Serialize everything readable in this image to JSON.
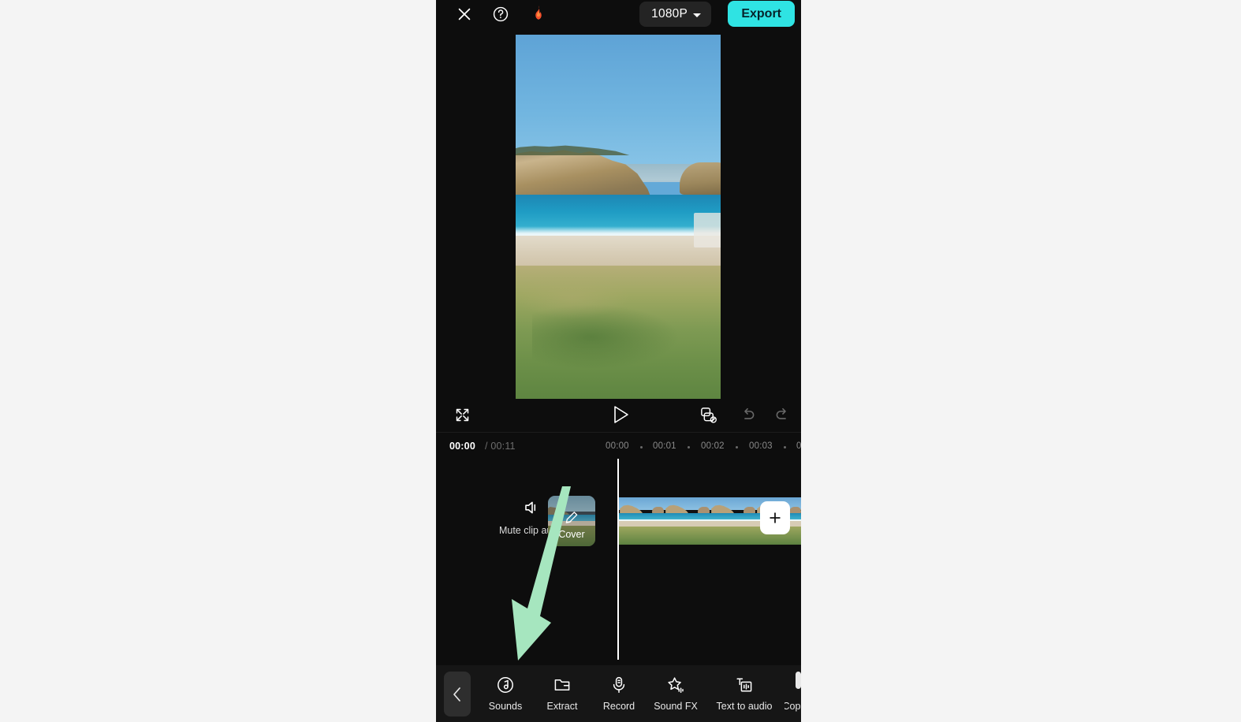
{
  "app": {
    "name": "video-editor"
  },
  "topbar": {
    "close_icon": "close-icon",
    "help_icon": "help-circle-icon",
    "flame_icon": "flame-icon",
    "flame_glyph": "🔥",
    "resolution_label": "1080P",
    "export_label": "Export",
    "export_color": "#2fe3e3"
  },
  "player": {
    "expand_icon": "fullscreen-icon",
    "play_icon": "play-icon",
    "no_duplicate_icon": "no-duplicate-icon",
    "undo_icon": "undo-icon",
    "redo_icon": "redo-icon"
  },
  "timeline": {
    "current_time": "00:00",
    "separator": "/",
    "total_time": "00:11",
    "ruler_labels": [
      "00:00",
      "00:01",
      "00:02",
      "00:03"
    ],
    "mute_label": "Mute clip audio",
    "mute_icon": "speaker-icon",
    "cover_label": "Cover",
    "cover_edit_icon": "pencil-icon",
    "add_label": "+",
    "playhead_position": "00:00"
  },
  "toolbar": {
    "back_icon": "chevron-left-icon",
    "items": [
      {
        "label": "Sounds",
        "icon": "music-note-circle-icon"
      },
      {
        "label": "Extract",
        "icon": "folder-icon"
      },
      {
        "label": "Record",
        "icon": "microphone-icon"
      },
      {
        "label": "Sound FX",
        "icon": "star-sound-icon"
      },
      {
        "label": "Text to audio",
        "icon": "text-to-audio-icon"
      },
      {
        "label": "Cop",
        "icon": "copyright-icon"
      }
    ]
  },
  "annotation": {
    "arrow_color": "#a6e6bf",
    "arrow_direction": "down-left"
  }
}
